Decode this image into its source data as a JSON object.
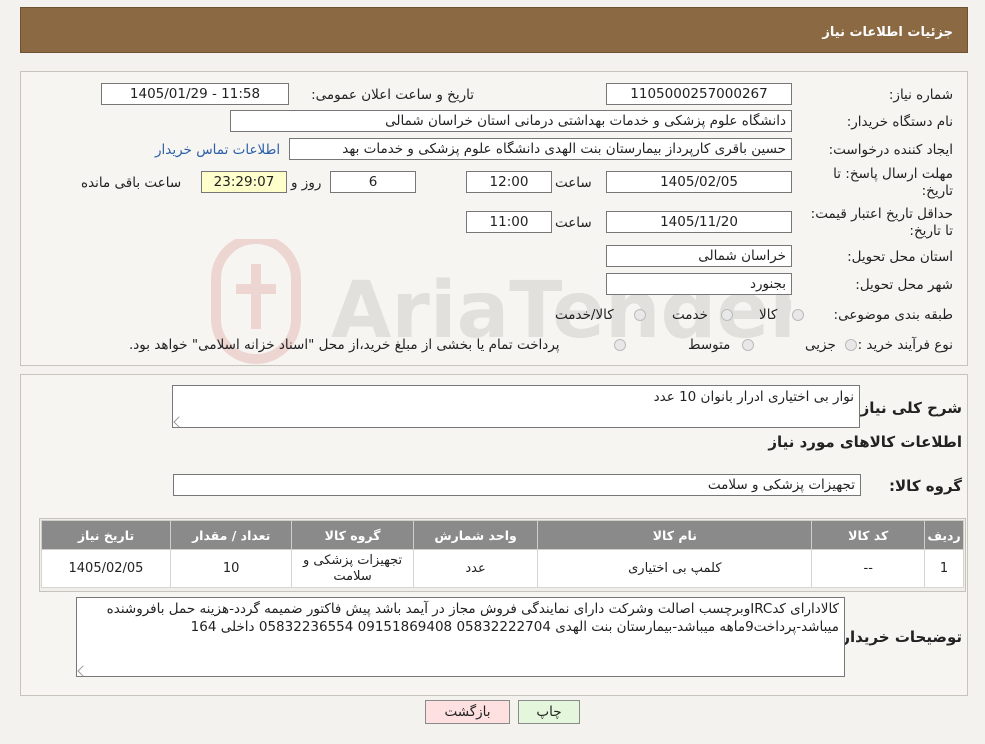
{
  "header": {
    "title": "جزئیات اطلاعات نیاز"
  },
  "form": {
    "need_number_label": "شماره نیاز:",
    "need_number": "1105000257000267",
    "announce_label": "تاریخ و ساعت اعلان عمومی:",
    "announce_value": "1405/01/29 - 11:58",
    "buyer_org_label": "نام دستگاه خریدار:",
    "buyer_org": "دانشگاه علوم پزشکی و خدمات بهداشتی درمانی استان خراسان شمالی",
    "requester_label": "ایجاد کننده درخواست:",
    "requester": "حسین باقری کارپرداز بیمارستان بنت الهدی دانشگاه علوم پزشکی و خدمات بهد",
    "contact_link": "اطلاعات تماس خریدار",
    "send_deadline_label": "مهلت ارسال پاسخ: تا تاریخ:",
    "send_deadline_date": "1405/02/05",
    "time_label": "ساعت",
    "send_deadline_time": "12:00",
    "days_value": "6",
    "days_label": "روز و",
    "remaining_time": "23:29:07",
    "remaining_label": "ساعت باقی مانده",
    "price_validity_label": "حداقل تاریخ اعتبار قیمت: تا تاریخ:",
    "price_validity_date": "1405/11/20",
    "price_validity_time": "11:00",
    "province_label": "استان محل تحویل:",
    "province": "خراسان شمالی",
    "city_label": "شهر محل تحویل:",
    "city": "بجنورد",
    "category_label": "طبقه بندی موضوعی:",
    "category_options": [
      "کالا",
      "خدمت",
      "کالا/خدمت"
    ],
    "process_label": "نوع فرآیند خرید :",
    "process_options": [
      "جزیی",
      "متوسط"
    ],
    "process_note": "پرداخت تمام یا بخشی از مبلغ خرید،از محل \"اسناد خزانه اسلامی\" خواهد بود."
  },
  "details": {
    "summary_label": "شرح کلی نیاز:",
    "summary": "نوار بی اختیاری ادرار بانوان 10 عدد",
    "items_heading": "اطلاعات کالاهای مورد نیاز",
    "group_label": "گروه کالا:",
    "group_value": "تجهیزات پزشکی و سلامت",
    "table": {
      "headers": [
        "ردیف",
        "کد کالا",
        "نام کالا",
        "واحد شمارش",
        "گروه کالا",
        "تعداد / مقدار",
        "تاریخ نیاز"
      ],
      "rows": [
        [
          "1",
          "--",
          "کلمپ بی اختیاری",
          "عدد",
          "تجهیزات پزشکی و سلامت",
          "10",
          "1405/02/05"
        ]
      ]
    },
    "buyer_notes_label": "توضیحات خریدار:",
    "buyer_notes": "کالادارای کدIRCوبرچسب اصالت وشرکت دارای نمایندگی فروش مجاز در آیمد باشد پیش فاکتور ضمیمه گردد-هزینه حمل بافروشنده میباشد-پرداخت9ماهه میباشد-بیمارستان بنت الهدی 05832222704 09151869408 05832236554  داخلی 164"
  },
  "buttons": {
    "print": "چاپ",
    "back": "بازگشت"
  },
  "colors": {
    "header": "#8b6a43",
    "table_header": "#8a8a8a",
    "back_button": "#ffe0e0",
    "print_button": "#e4f7dc"
  }
}
